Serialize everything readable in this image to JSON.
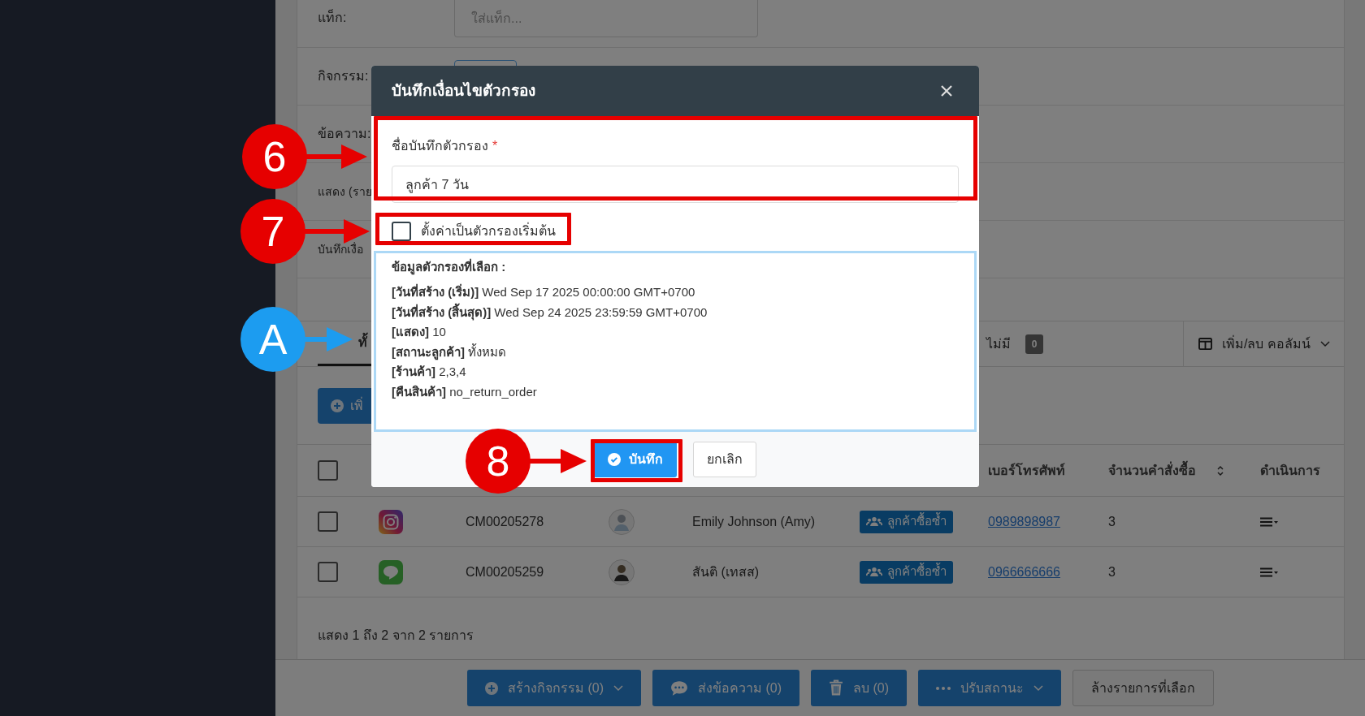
{
  "filter_form": {
    "rows": [
      {
        "label": "แท็ก:",
        "kind": "input",
        "placeholder": "ใส่แท็ก..."
      },
      {
        "label": "กิจกรรม:",
        "kind": "select"
      },
      {
        "label": "ข้อความ:",
        "kind": "text"
      },
      {
        "label": "แสดง (ราย",
        "kind": "text"
      },
      {
        "label": "บันทึกเงื่อ",
        "kind": "text"
      }
    ]
  },
  "tabs": [
    {
      "label": "ทั้",
      "selected": true
    }
  ],
  "status_filter": {
    "label": "ไม่มี",
    "count": "0"
  },
  "column_toggle": {
    "label": "เพิ่ม/ลบ คอลัมน์"
  },
  "add_button": {
    "label": "เพิ่"
  },
  "table": {
    "columns": [
      {
        "kind": "checkbox",
        "checked": false
      },
      {
        "kind": "text",
        "label": "เบอร์โทรศัพท์"
      },
      {
        "kind": "sortable",
        "label": "จำนวนคำสั่งซื้อ"
      },
      {
        "kind": "text",
        "label": "ดำเนินการ"
      }
    ],
    "rows": [
      {
        "checked": false,
        "kind": "camera",
        "id": "CM00205278",
        "name": "Emily Johnson (Amy)",
        "tag": "ลูกค้าซื้อซ้ำ",
        "phone": "0989898987",
        "orders": "3"
      },
      {
        "checked": false,
        "kind": "chat",
        "id": "CM00205259",
        "name": "สันติ (เทสส)",
        "tag": "ลูกค้าซื้อซ้ำ",
        "phone": "0966666666",
        "orders": "3"
      }
    ]
  },
  "summary": "แสดง 1 ถึง 2 จาก 2 รายการ",
  "bulk_actions": [
    {
      "kind": "create",
      "label": "สร้างกิจกรรม (0)"
    },
    {
      "kind": "sms",
      "label": "ส่งข้อความ (0)"
    },
    {
      "kind": "delete",
      "label": "ลบ (0)"
    },
    {
      "kind": "status",
      "label": "ปรับสถานะ"
    },
    {
      "kind": "clear",
      "label": "ล้างรายการที่เลือก"
    }
  ],
  "modal": {
    "title": "บันทึกเงื่อนไขตัวกรอง",
    "name_field": {
      "label": "ชื่อบันทึกตัวกรอง",
      "required_mark": "*",
      "value": "ลูกค้า 7 วัน"
    },
    "default_checkbox": {
      "label": "ตั้งค่าเป็นตัวกรองเริ่มต้น",
      "checked": false
    },
    "filter_info": {
      "heading": "ข้อมูลตัวกรองที่เลือก :",
      "lines": [
        "**[วันที่สร้าง (เริ่ม)]** Wed Sep 17 2025 00:00:00 GMT+0700",
        "**[วันที่สร้าง (สิ้นสุด)]** Wed Sep 24 2025 23:59:59 GMT+0700",
        "**[แสดง]** 10",
        "**[สถานะลูกค้า]** ทั้งหมด",
        "**[ร้านค้า]** 2,3,4",
        "**[คืนสินค้า]** no_return_order"
      ]
    },
    "buttons": [
      {
        "kind": "primary",
        "label": "บันทึก"
      },
      {
        "kind": "secondary",
        "label": "ยกเลิก"
      }
    ]
  },
  "annotations": [
    {
      "label": "6",
      "color": "#e60000",
      "boxed": true
    },
    {
      "label": "7",
      "color": "#e60000",
      "boxed": true
    },
    {
      "label": "A",
      "color": "#1c9cf0",
      "boxed": false
    },
    {
      "label": "8",
      "color": "#e60000",
      "boxed": true
    }
  ]
}
